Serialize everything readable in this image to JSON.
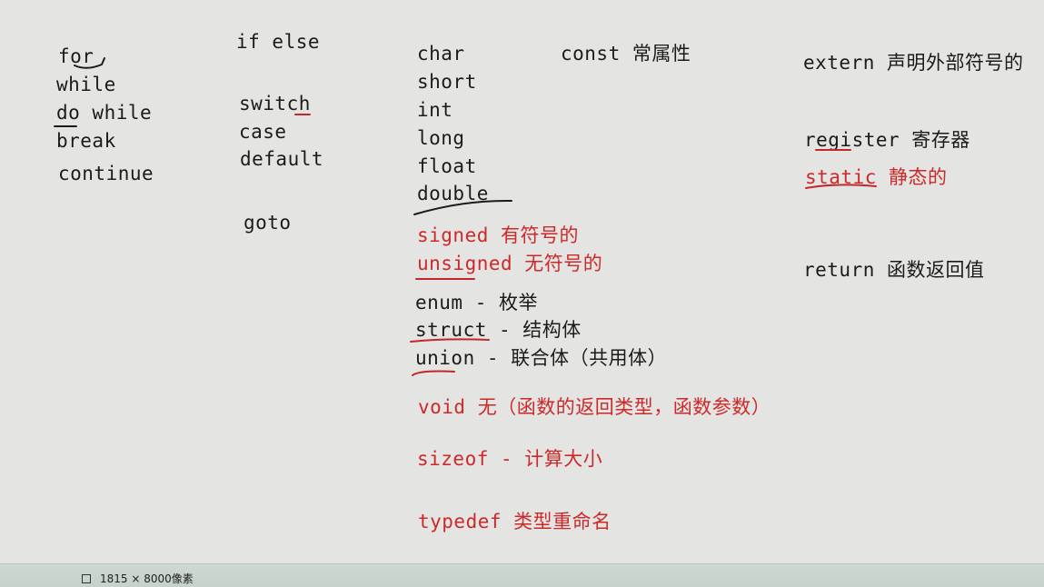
{
  "loop_keywords": [
    "for",
    "while",
    "do while",
    "break",
    "continue"
  ],
  "branch_keywords": [
    "if else",
    "switch",
    "case",
    "default",
    "goto"
  ],
  "type_keywords": [
    "char",
    "short",
    "int",
    "long",
    "float",
    "double"
  ],
  "const_note": "const 常属性",
  "signed_note": "signed  有符号的",
  "unsigned_note": "unsigned 无符号的",
  "enum_note": "enum - 枚举",
  "struct_note": "struct - 结构体",
  "union_note": "union - 联合体（共用体）",
  "void_note": "void  无（函数的返回类型，函数参数）",
  "sizeof_note": "sizeof - 计算大小",
  "typedef_note": "typedef 类型重命名",
  "extern_note": "extern 声明外部符号的",
  "register_note": "register 寄存器",
  "static_note": "static 静态的",
  "return_note": "return 函数返回值",
  "status_bar": {
    "image_size": "1815 × 8000像素"
  },
  "colors": {
    "text": "#1b1b1b",
    "red_text": "#cc2a2a",
    "background": "#e4e4e2"
  }
}
